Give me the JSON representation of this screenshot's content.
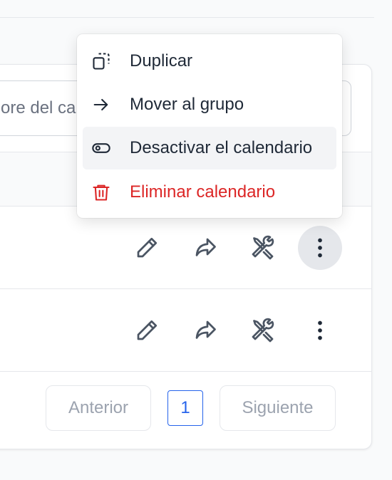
{
  "search": {
    "value_visible": "ore del ca"
  },
  "menu": {
    "items": [
      {
        "label": "Duplicar",
        "icon": "duplicate-icon"
      },
      {
        "label": "Mover al grupo",
        "icon": "arrow-right-icon"
      },
      {
        "label": "Desactivar el calendario",
        "icon": "toggle-icon"
      },
      {
        "label": "Eliminar calendario",
        "icon": "trash-icon"
      }
    ]
  },
  "rows": [
    {
      "actions": [
        "edit-icon",
        "share-icon",
        "tools-icon",
        "more-icon"
      ]
    },
    {
      "actions": [
        "edit-icon",
        "share-icon",
        "tools-icon",
        "more-icon"
      ]
    }
  ],
  "pagination": {
    "prev": "Anterior",
    "page": "1",
    "next": "Siguiente"
  },
  "colors": {
    "danger": "#dc2626",
    "accent": "#2563eb",
    "icon": "#4b5563"
  }
}
